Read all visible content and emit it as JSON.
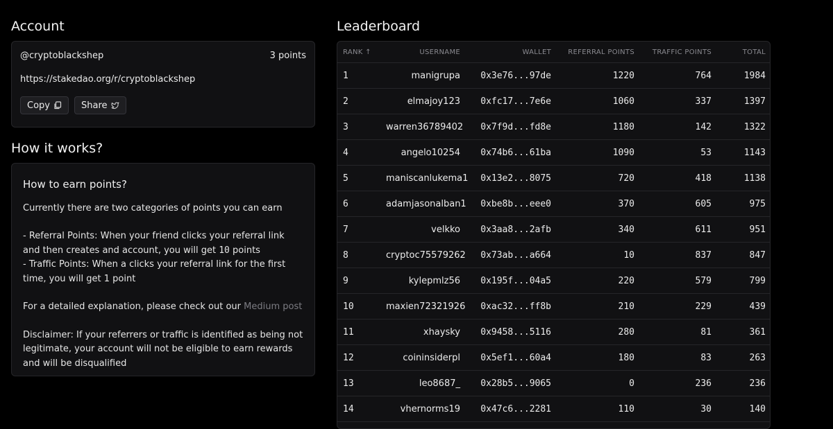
{
  "account": {
    "title": "Account",
    "username": "@cryptoblackshep",
    "points": "3 points",
    "referral_link": "https://stakedao.org/r/cryptoblackshep",
    "copy_label": "Copy",
    "share_label": "Share"
  },
  "how": {
    "title": "How it works?",
    "subtitle": "How to earn points?",
    "intro": "Currently there are two categories of points you can earn",
    "referral_a": "- Referral Points: When your friend clicks your referral link and then creates and account, you will get ",
    "referral_num": "10",
    "referral_b": " points",
    "traffic": "- Traffic Points: When a clicks your referral link for the first time, you will get 1 point",
    "explain_prefix": "For a detailed explanation, please check out our ",
    "explain_link": "Medium post",
    "disclaimer": "Disclaimer: If your referrers or traffic is identified as being not legitimate, your account will not be eligible to earn rewards and will be disqualified"
  },
  "leaderboard": {
    "title": "Leaderboard",
    "columns": {
      "rank": "RANK",
      "username": "USERNAME",
      "wallet": "WALLET",
      "referral": "REFERRAL POINTS",
      "traffic": "TRAFFIC POINTS",
      "total": "TOTAL"
    },
    "rows": [
      {
        "rank": "1",
        "username": "manigrupa",
        "wallet": "0x3e76...97de",
        "referral": "1220",
        "traffic": "764",
        "total": "1984"
      },
      {
        "rank": "2",
        "username": "elmajoy123",
        "wallet": "0xfc17...7e6e",
        "referral": "1060",
        "traffic": "337",
        "total": "1397"
      },
      {
        "rank": "3",
        "username": "warren36789402",
        "wallet": "0x7f9d...fd8e",
        "referral": "1180",
        "traffic": "142",
        "total": "1322"
      },
      {
        "rank": "4",
        "username": "angelo10254",
        "wallet": "0x74b6...61ba",
        "referral": "1090",
        "traffic": "53",
        "total": "1143"
      },
      {
        "rank": "5",
        "username": "maniscanlukema1",
        "wallet": "0x13e2...8075",
        "referral": "720",
        "traffic": "418",
        "total": "1138"
      },
      {
        "rank": "6",
        "username": "adamjasonalban1",
        "wallet": "0xbe8b...eee0",
        "referral": "370",
        "traffic": "605",
        "total": "975"
      },
      {
        "rank": "7",
        "username": "velkko",
        "wallet": "0x3aa8...2afb",
        "referral": "340",
        "traffic": "611",
        "total": "951"
      },
      {
        "rank": "8",
        "username": "cryptoc75579262",
        "wallet": "0x73ab...a664",
        "referral": "10",
        "traffic": "837",
        "total": "847"
      },
      {
        "rank": "9",
        "username": "kylepmlz56",
        "wallet": "0x195f...04a5",
        "referral": "220",
        "traffic": "579",
        "total": "799"
      },
      {
        "rank": "10",
        "username": "maxien72321926",
        "wallet": "0xac32...ff8b",
        "referral": "210",
        "traffic": "229",
        "total": "439"
      },
      {
        "rank": "11",
        "username": "xhaysky",
        "wallet": "0x9458...5116",
        "referral": "280",
        "traffic": "81",
        "total": "361"
      },
      {
        "rank": "12",
        "username": "coininsiderpl",
        "wallet": "0x5ef1...60a4",
        "referral": "180",
        "traffic": "83",
        "total": "263"
      },
      {
        "rank": "13",
        "username": "leo8687_",
        "wallet": "0x28b5...9065",
        "referral": "0",
        "traffic": "236",
        "total": "236"
      },
      {
        "rank": "14",
        "username": "vhernorms19",
        "wallet": "0x47c6...2281",
        "referral": "110",
        "traffic": "30",
        "total": "140"
      }
    ]
  }
}
